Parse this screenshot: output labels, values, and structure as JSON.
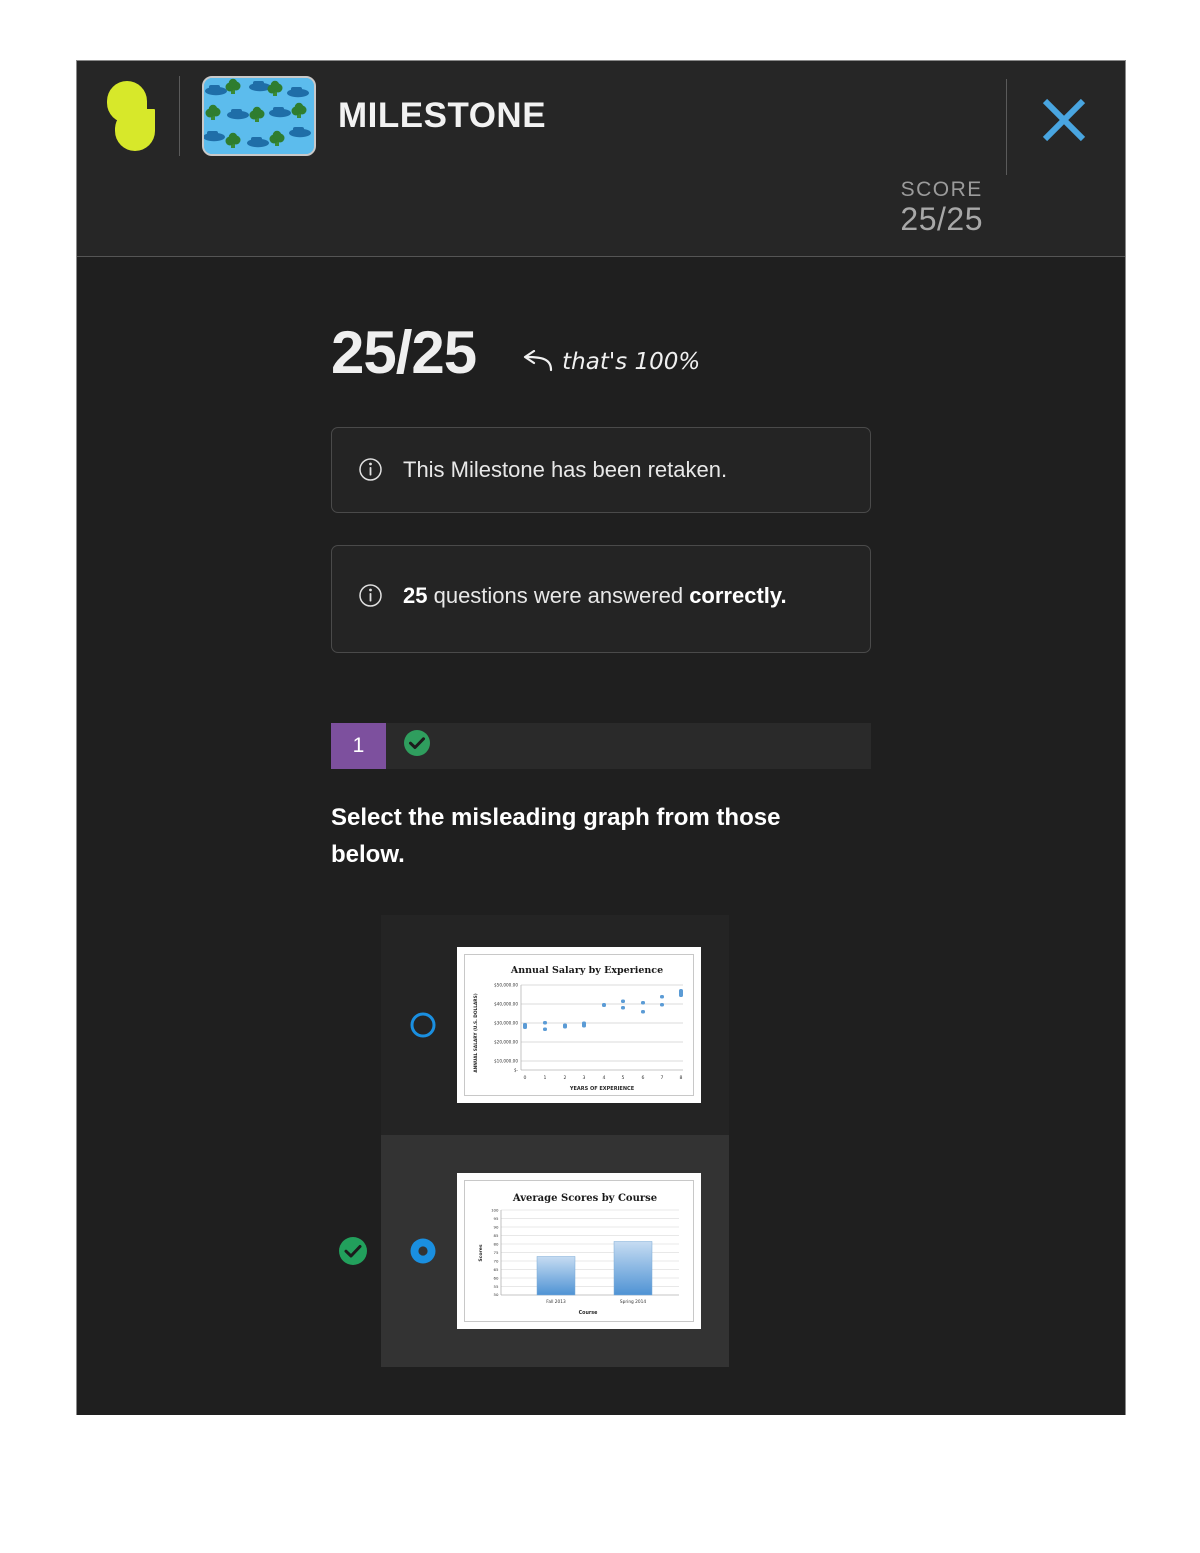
{
  "header": {
    "logo_icon": "sophia-leaf-logo",
    "thumbnail_icon": "course-thumbnail-cars-trees-pattern",
    "title": "MILESTONE",
    "close_icon": "close-x-icon",
    "score_label": "SCORE",
    "score_value": "25/25",
    "accent_close": "#49a5e0",
    "accent_logo": "#d7e82a"
  },
  "summary": {
    "big_score": "25/25",
    "percent_note": "that's 100%",
    "arrow_icon": "curved-left-arrow-icon",
    "notices": [
      {
        "icon": "info-circle-icon",
        "text": "This Milestone has been retaken.",
        "bold_prefix": "",
        "bold_suffix": ""
      },
      {
        "icon": "info-circle-icon",
        "bold_prefix": "25",
        "text": " questions were answered ",
        "bold_suffix": "correctly."
      }
    ]
  },
  "question": {
    "number": "1",
    "number_bg": "#7d509e",
    "correct_icon": "check-circle-icon",
    "correct_color": "#2f9e5e",
    "prompt": "Select the misleading graph from those below.",
    "options": [
      {
        "id": "option-1",
        "selected": false,
        "is_correct_answer": false,
        "radio_icon": "radio-unselected-icon",
        "figure_type": "scatter"
      },
      {
        "id": "option-2",
        "selected": true,
        "is_correct_answer": true,
        "radio_icon": "radio-selected-icon",
        "correct_marker_icon": "check-circle-icon",
        "figure_type": "bar"
      }
    ]
  },
  "chart_data": [
    {
      "type": "scatter",
      "title": "Annual Salary by Experience",
      "xlabel": "YEARS OF EXPERIENCE",
      "ylabel": "ANNUAL SALARY (U.S. DOLLARS)",
      "xlim": [
        0,
        8
      ],
      "ylim": [
        0,
        50000
      ],
      "xticks": [
        "0",
        "1",
        "2",
        "3",
        "4",
        "5",
        "6",
        "7",
        "8"
      ],
      "yticks": [
        "$-",
        "$10,000.00",
        "$20,000.00",
        "$30,000.00",
        "$40,000.00",
        "$50,000.00"
      ],
      "grid": true,
      "legend": "none",
      "point_color": "#5b9bd5",
      "points": [
        {
          "x": 0,
          "y": 29000
        },
        {
          "x": 0,
          "y": 29800
        },
        {
          "x": 1,
          "y": 29200
        },
        {
          "x": 1,
          "y": 33500
        },
        {
          "x": 2,
          "y": 32000
        },
        {
          "x": 2,
          "y": 33200
        },
        {
          "x": 3,
          "y": 32600
        },
        {
          "x": 3,
          "y": 34000
        },
        {
          "x": 4,
          "y": 41000
        },
        {
          "x": 5,
          "y": 40000
        },
        {
          "x": 5,
          "y": 43500
        },
        {
          "x": 6,
          "y": 38800
        },
        {
          "x": 6,
          "y": 42500
        },
        {
          "x": 7,
          "y": 41800
        },
        {
          "x": 7,
          "y": 45000
        },
        {
          "x": 8,
          "y": 46000
        },
        {
          "x": 8,
          "y": 47500
        }
      ]
    },
    {
      "type": "bar",
      "title": "Average Scores by Course",
      "xlabel": "Course",
      "ylabel": "Scores",
      "categories": [
        "Fall 2013",
        "Spring 2014"
      ],
      "values": [
        73,
        82
      ],
      "ylim": [
        50,
        100
      ],
      "yticks": [
        "50",
        "55",
        "60",
        "65",
        "70",
        "75",
        "80",
        "85",
        "90",
        "95",
        "100"
      ],
      "grid": true,
      "legend": "none",
      "bar_color": "#5b9bd5"
    }
  ]
}
